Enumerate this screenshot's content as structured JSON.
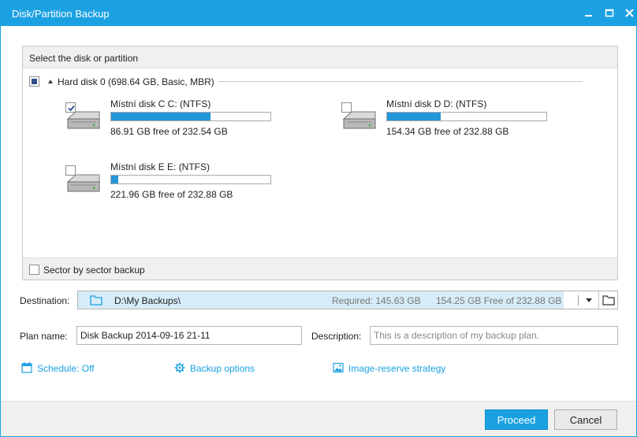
{
  "window": {
    "title": "Disk/Partition Backup"
  },
  "panel": {
    "header": "Select the disk or partition",
    "disk": {
      "label": "Hard disk 0 (698.64 GB, Basic, MBR)"
    },
    "partitions": [
      {
        "name": "Místní disk C C: (NTFS)",
        "free": "86.91 GB free of 232.54 GB",
        "checked": true,
        "used_fraction": 0.626
      },
      {
        "name": "Místní disk D D: (NTFS)",
        "free": "154.34 GB free of 232.88 GB",
        "checked": false,
        "used_fraction": 0.337
      },
      {
        "name": "Místní disk E E: (NTFS)",
        "free": "221.96 GB free of 232.88 GB",
        "checked": false,
        "used_fraction": 0.047
      }
    ],
    "sector_backup": "Sector by sector backup"
  },
  "destination": {
    "label": "Destination:",
    "path": "D:\\My Backups\\",
    "required": "Required: 145.63 GB",
    "free": "154.25 GB Free of 232.88 GB"
  },
  "plan": {
    "label": "Plan name:",
    "value": "Disk Backup 2014-09-16 21-11"
  },
  "description": {
    "label": "Description:",
    "placeholder": "This is a description of my backup plan."
  },
  "links": {
    "schedule": "Schedule: Off",
    "backup_options": "Backup options",
    "image_strategy": "Image-reserve strategy"
  },
  "buttons": {
    "proceed": "Proceed",
    "cancel": "Cancel"
  },
  "icons": [
    "minimize-icon",
    "maximize-icon",
    "close-icon",
    "hard-drive-icon",
    "folder-icon",
    "chevron-down-icon",
    "calendar-icon",
    "gear-icon",
    "image-icon"
  ],
  "colors": {
    "accent": "#1ba1e2",
    "bar_fill": "#2596d7"
  }
}
